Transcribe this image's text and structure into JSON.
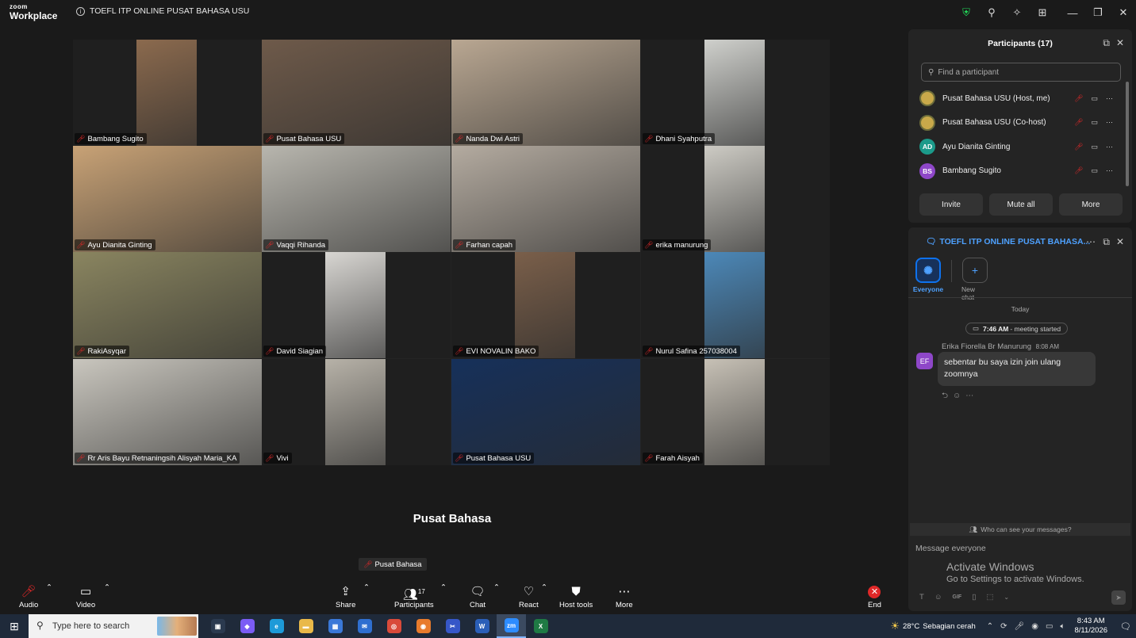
{
  "window": {
    "logo_line1": "zoom",
    "logo_line2": "Workplace",
    "meeting_title": "TOEFL ITP ONLINE PUSAT BAHASA USU"
  },
  "title_icons": [
    "shield-check-icon",
    "wand-icon",
    "sparkle-icon",
    "apps-grid-icon",
    "minimize-icon",
    "restore-icon",
    "close-icon"
  ],
  "gallery": {
    "tiles": [
      {
        "name": "Bambang Sugito",
        "muted": true,
        "bg": "#8b6a4e",
        "layout": "narrow",
        "row": 0,
        "col": 0
      },
      {
        "name": "Pusat Bahasa USU",
        "muted": true,
        "bg": "#6e5a4a",
        "layout": "full",
        "active": true,
        "row": 0,
        "col": 1
      },
      {
        "name": "Nanda Dwi Astri",
        "muted": true,
        "bg": "#b9a792",
        "layout": "full",
        "row": 0,
        "col": 2
      },
      {
        "name": "Dhani Syahputra",
        "muted": true,
        "bg": "#cfd0cc",
        "layout": "narrow",
        "row": 0,
        "col": 3
      },
      {
        "name": "Ayu Dianita Ginting",
        "muted": true,
        "bg": "#c8a276",
        "layout": "full",
        "row": 1,
        "col": 0
      },
      {
        "name": "Vaqqi Rihanda",
        "muted": true,
        "bg": "#b8b6ae",
        "layout": "full",
        "row": 1,
        "col": 1
      },
      {
        "name": "Farhan capah",
        "muted": true,
        "bg": "#b4aba0",
        "layout": "full",
        "row": 1,
        "col": 2
      },
      {
        "name": "erika manurung",
        "muted": true,
        "bg": "#cdcbc4",
        "layout": "narrow",
        "row": 1,
        "col": 3
      },
      {
        "name": "RakiAsyqar",
        "muted": true,
        "bg": "#8a8560",
        "layout": "full",
        "row": 2,
        "col": 0
      },
      {
        "name": "David Siagian",
        "muted": true,
        "bg": "#d8d6d2",
        "layout": "narrow",
        "row": 2,
        "col": 1
      },
      {
        "name": "EVI NOVALIN BAKO",
        "muted": true,
        "bg": "#7a5f4a",
        "layout": "narrow",
        "row": 2,
        "col": 2
      },
      {
        "name": "Nurul Safina 257038004",
        "muted": true,
        "bg": "#4c88b8",
        "layout": "narrow",
        "row": 2,
        "col": 3
      },
      {
        "name": "Rr Aris Bayu Retnaningsih Alisyah Maria_KA",
        "muted": true,
        "bg": "#c9c6be",
        "layout": "full",
        "row": 3,
        "col": 0
      },
      {
        "name": "Vivi",
        "muted": true,
        "bg": "#b7b2a8",
        "layout": "narrow",
        "row": 3,
        "col": 1
      },
      {
        "name": "Pusat Bahasa USU",
        "muted": true,
        "bg": "#16305a",
        "layout": "full",
        "row": 3,
        "col": 2
      },
      {
        "name": "Farah Aisyah",
        "muted": true,
        "bg": "#c7c1b6",
        "layout": "narrow",
        "row": 3,
        "col": 3
      }
    ]
  },
  "active_speaker": {
    "name": "Pusat Bahasa",
    "tag": "Pusat Bahasa"
  },
  "toolbar": {
    "audio": "Audio",
    "video": "Video",
    "share": "Share",
    "participants": "Participants",
    "participants_count": "17",
    "chat": "Chat",
    "react": "React",
    "host_tools": "Host tools",
    "more": "More",
    "end": "End"
  },
  "participants_panel": {
    "title": "Participants (17)",
    "search_placeholder": "Find a participant",
    "list": [
      {
        "name": "Pusat Bahasa USU (Host, me)",
        "avatar": "",
        "type": "logo"
      },
      {
        "name": "Pusat Bahasa USU (Co-host)",
        "avatar": "",
        "type": "logo"
      },
      {
        "name": "Ayu Dianita Ginting",
        "avatar": "AD",
        "type": "ad"
      },
      {
        "name": "Bambang Sugito",
        "avatar": "BS",
        "type": "bs"
      }
    ],
    "invite": "Invite",
    "mute_all": "Mute all",
    "more": "More"
  },
  "chat_panel": {
    "title": "TOEFL ITP ONLINE PUSAT BAHASA...",
    "tab_everyone": "Everyone",
    "tab_new_chat": "New chat",
    "today": "Today",
    "started_time": "7:46 AM",
    "started_text": "- meeting started",
    "message": {
      "avatar": "EF",
      "sender": "Erika Fiorella Br Manurung",
      "time": "8:08 AM",
      "text": "sebentar bu saya izin join ulang zoomnya"
    },
    "who_can_see": "Who can see your messages?",
    "input_placeholder": "Message everyone",
    "activate_title": "Activate Windows",
    "activate_sub": "Go to Settings to activate Windows.",
    "gif_label": "GIF"
  },
  "taskbar": {
    "search_placeholder": "Type here to search",
    "weather_temp": "28°C",
    "weather_text": "Sebagian cerah",
    "time": "8:43 AM",
    "date": "8/11/2026",
    "apps": [
      "task-view-icon",
      "copilot-icon",
      "edge-icon",
      "file-explorer-icon",
      "store-icon",
      "mail-icon",
      "chrome-icon",
      "firefox-icon",
      "snipping-icon",
      "word-icon",
      "zoom-icon",
      "excel-icon"
    ]
  },
  "colors": {
    "accent_blue": "#0e72ed",
    "active_speaker_border": "#23d959",
    "mute_red": "#e02828"
  }
}
